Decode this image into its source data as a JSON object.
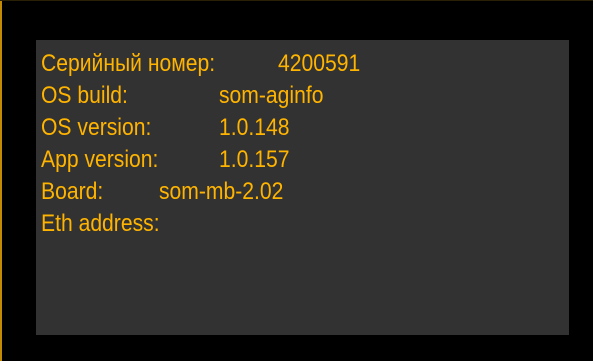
{
  "colors": {
    "background": "#000000",
    "panel": "#323232",
    "text": "#ffb400",
    "edge": "#c28a05"
  },
  "info": {
    "serial_label": "Серийный номер:",
    "serial_value": "4200591",
    "os_build_label": "OS build:",
    "os_build_value": "som-aginfo",
    "os_version_label": "OS version:",
    "os_version_value": "1.0.148",
    "app_version_label": "App version:",
    "app_version_value": "1.0.157",
    "board_label": "Board:",
    "board_value": "som-mb-2.02",
    "eth_label": "Eth address:",
    "eth_value": ""
  }
}
